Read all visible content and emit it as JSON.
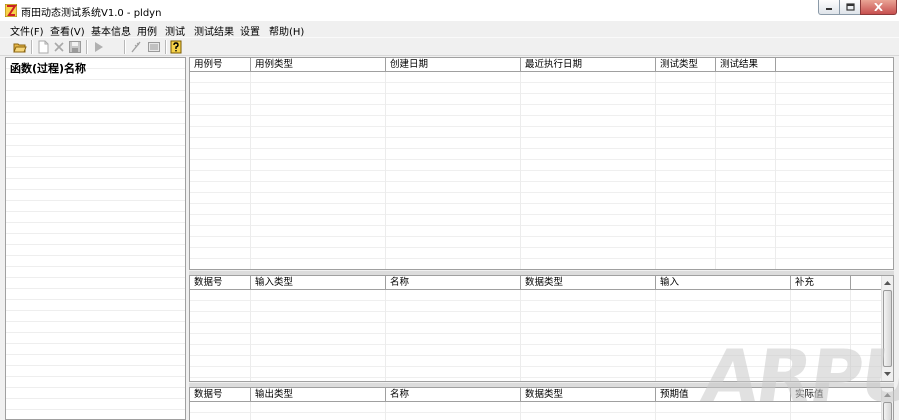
{
  "window": {
    "title": "雨田动态测试系统V1.0 - pldyn"
  },
  "menu": {
    "items": [
      "文件(F)",
      "查看(V)",
      "基本信息",
      "用例",
      "测试",
      "测试结果",
      "设置",
      "帮助(H)"
    ]
  },
  "toolbar": {
    "buttons": [
      "open-folder-icon",
      "new-document-icon",
      "delete-icon",
      "save-icon",
      "run-icon",
      "edit-icon",
      "list-icon",
      "help-icon"
    ]
  },
  "left_panel": {
    "header": "函数(过程)名称"
  },
  "case_grid": {
    "columns": [
      "用例号",
      "用例类型",
      "创建日期",
      "最近执行日期",
      "测试类型",
      "测试结果",
      ""
    ]
  },
  "input_grid": {
    "columns": [
      "数据号",
      "输入类型",
      "名称",
      "数据类型",
      "输入",
      "补充",
      ""
    ]
  },
  "output_grid": {
    "columns": [
      "数据号",
      "输出类型",
      "名称",
      "数据类型",
      "预期值",
      "实际值"
    ]
  },
  "watermark": {
    "text": "ARPUN"
  },
  "colors": {
    "close_button": "#c75050",
    "grid_border": "#a0a0a0",
    "background": "#f0f0f0"
  }
}
